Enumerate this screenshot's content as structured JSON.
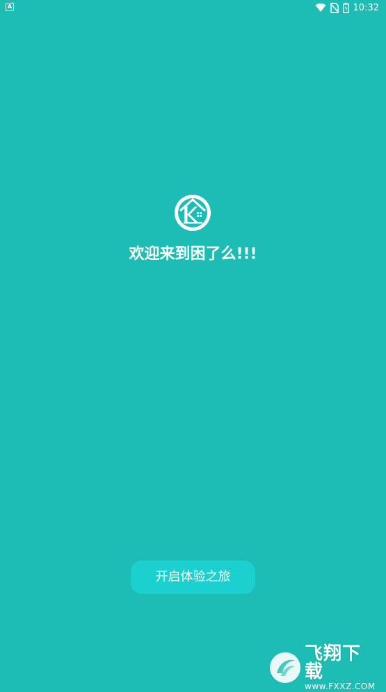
{
  "status_bar": {
    "left_icon_letter": "A",
    "time": "10:32",
    "icons": [
      "wifi-icon",
      "no-sim-icon",
      "battery-icon"
    ]
  },
  "main": {
    "logo_icon": "house-k-logo-icon",
    "welcome_text": "欢迎来到困了么!!!",
    "start_button_label": "开启体验之旅"
  },
  "watermark": {
    "title": "飞翔下载",
    "url": "www.FXXZ.COM"
  },
  "colors": {
    "background": "#1dbcb4",
    "button": "#1bd0cf",
    "text": "#ffffff"
  }
}
